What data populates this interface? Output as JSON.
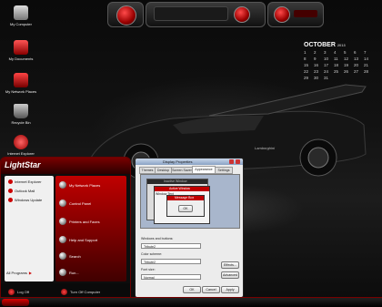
{
  "desktop_icons": [
    {
      "label": "My Computer"
    },
    {
      "label": "My Documents"
    },
    {
      "label": "My Network Places"
    },
    {
      "label": "Recycle Bin"
    },
    {
      "label": "Internet Explorer"
    }
  ],
  "calendar": {
    "month": "OCTOBER",
    "year": "2013",
    "weeks": [
      [
        "1",
        "2",
        "3",
        "4",
        "5",
        "6",
        "7"
      ],
      [
        "8",
        "9",
        "10",
        "11",
        "12",
        "13",
        "14"
      ],
      [
        "15",
        "16",
        "17",
        "18",
        "19",
        "20",
        "21"
      ],
      [
        "22",
        "23",
        "24",
        "25",
        "26",
        "27",
        "28"
      ],
      [
        "29",
        "30",
        "31",
        "",
        "",
        "",
        ""
      ]
    ]
  },
  "car_badge": "Lamborghini",
  "start_menu": {
    "title": "LightStar",
    "left_items": [
      {
        "label": "Internet Explorer"
      },
      {
        "label": "Outlook Mail"
      },
      {
        "label": "Windows Update"
      }
    ],
    "all_programs": "All Programs",
    "right_items": [
      {
        "label": "My Network Places"
      },
      {
        "label": "Control Panel"
      },
      {
        "label": "Printers and Faxes"
      },
      {
        "label": "Help and Support"
      },
      {
        "label": "Search"
      },
      {
        "label": "Run..."
      }
    ],
    "log_off": "Log Off",
    "turn_off": "Turn Off Computer"
  },
  "display_properties": {
    "title": "Display Properties",
    "tabs": [
      "Themes",
      "Desktop",
      "Screen Saver",
      "Appearance",
      "Settings"
    ],
    "preview": {
      "inactive_window": "Inactive Window",
      "active_window": "Active Window",
      "window_text": "Window Text",
      "message_box": "Message Box",
      "ok": "OK"
    },
    "windows_and_buttons_label": "Windows and buttons:",
    "windows_and_buttons_value": "Tribute2",
    "color_scheme_label": "Color scheme:",
    "color_scheme_value": "Tribute2",
    "font_size_label": "Font size:",
    "font_size_value": "Normal",
    "effects_button": "Effects...",
    "advanced_button": "Advanced",
    "ok_button": "OK",
    "cancel_button": "Cancel",
    "apply_button": "Apply"
  },
  "colors": {
    "accent": "#c00000"
  }
}
